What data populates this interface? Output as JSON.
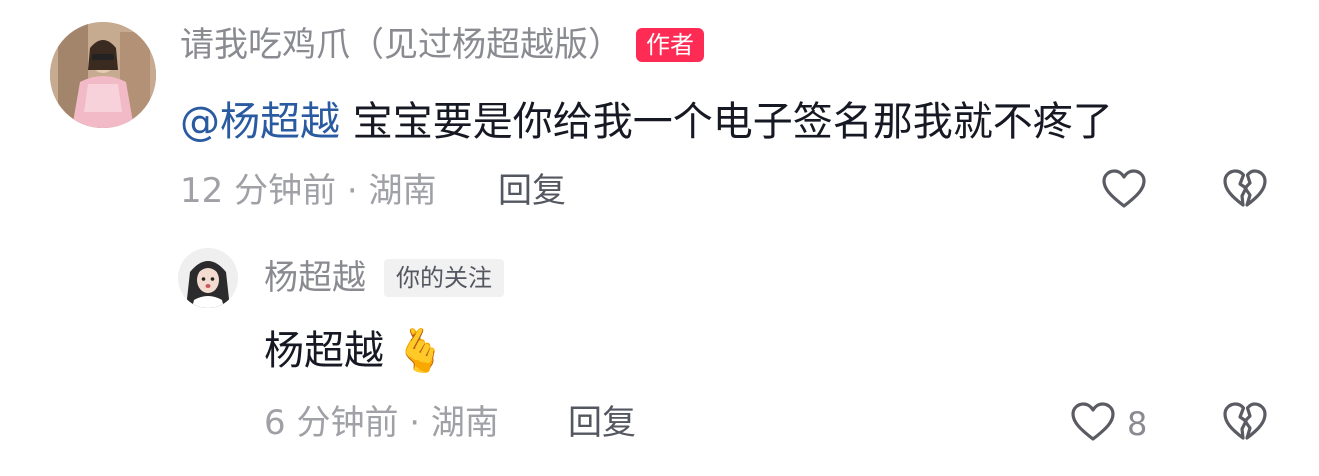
{
  "comment": {
    "username": "请我吃鸡爪（见过杨超越版）",
    "author_badge": "作者",
    "mention": "@杨超越",
    "text": "宝宝要是你给我一个电子签名那我就不疼了",
    "time": "12 分钟前 · 湖南",
    "reply_label": "回复",
    "icons": [
      "heart-outline-icon",
      "broken-heart-icon"
    ]
  },
  "reply": {
    "username": "杨超越",
    "follow_badge": "你的关注",
    "text": "杨超越",
    "emoji": "🫰",
    "time": "6 分钟前 · 湖南",
    "reply_label": "回复",
    "like_count": "8",
    "icons": [
      "heart-outline-icon",
      "broken-heart-icon"
    ]
  }
}
